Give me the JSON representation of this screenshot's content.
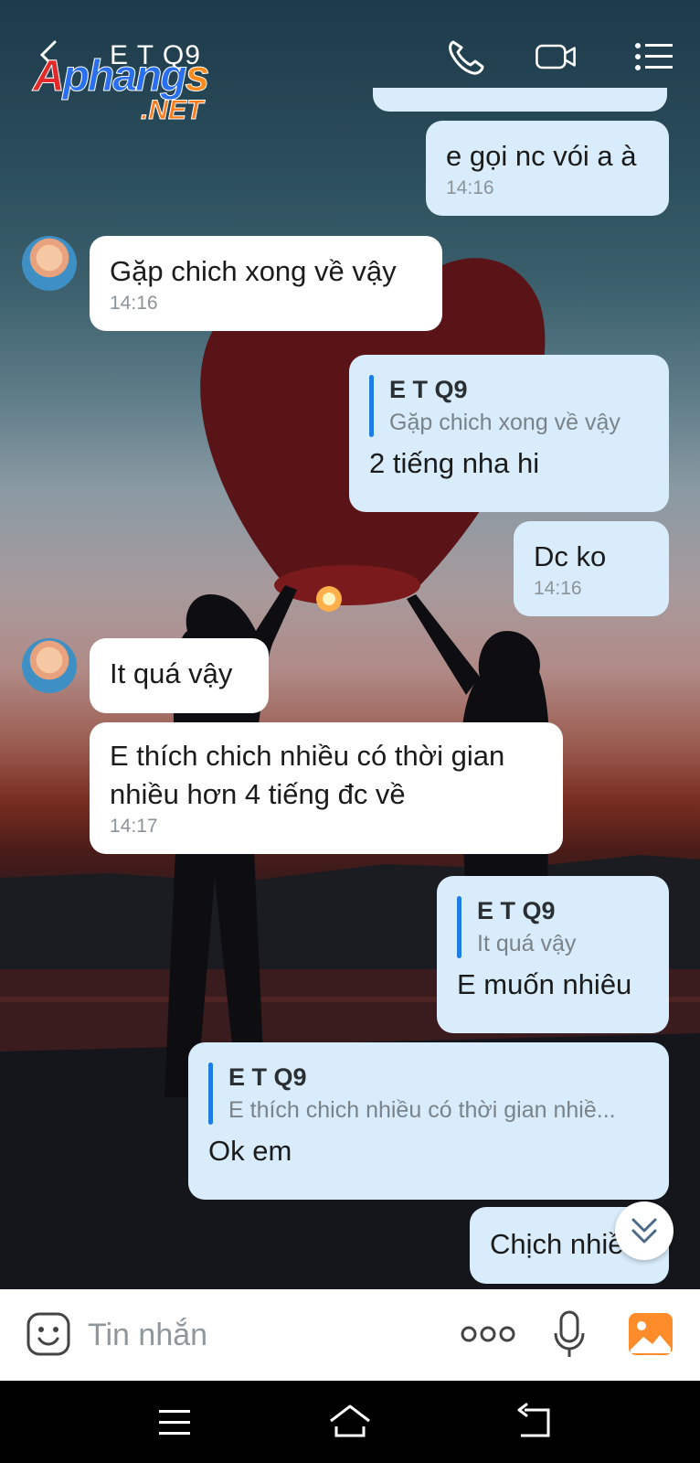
{
  "header": {
    "title": "E T Q9",
    "back_icon": "arrow-left-icon",
    "call_icon": "phone-icon",
    "video_icon": "video-icon",
    "menu_icon": "list-menu-icon"
  },
  "watermark": {
    "text_a": "A",
    "text_b": "phang",
    "text_c": "s",
    "sub": ".NET"
  },
  "messages": [
    {
      "dir": "out",
      "text": "e gọi nc vói a à",
      "time": "14:16"
    },
    {
      "dir": "in",
      "text": "Gặp chich xong về vậy",
      "time": "14:16"
    },
    {
      "dir": "out",
      "quote_name": "E T Q9",
      "quote_text": "Gặp chich xong về vậy",
      "text": "2 tiếng nha hi"
    },
    {
      "dir": "out",
      "text": "Dc ko",
      "time": "14:16"
    },
    {
      "dir": "in",
      "text": "It quá vậy"
    },
    {
      "dir": "in",
      "text_line1": "E thích chich nhiều có thời gian",
      "text_line2": "nhiều hơn 4 tiếng đc về",
      "time": "14:17"
    },
    {
      "dir": "out",
      "quote_name": "E T Q9",
      "quote_text": "It quá vậy",
      "text": "E muốn nhiêu"
    },
    {
      "dir": "out",
      "quote_name": "E T Q9",
      "quote_text": "E thích chich nhiều có thời gian nhiề...",
      "text": "Ok em"
    },
    {
      "dir": "out",
      "text": "Chịch nhiề"
    }
  ],
  "input": {
    "placeholder": "Tin nhắn",
    "emoji_icon": "sticker-smile-icon",
    "more_icon": "more-dots-icon",
    "mic_icon": "microphone-icon",
    "image_icon": "image-gallery-icon"
  },
  "scroll_icon": "double-chevron-down-icon",
  "nav": {
    "menu_icon": "nav-menu-icon",
    "home_icon": "nav-home-icon",
    "back_icon": "nav-back-icon"
  },
  "colors": {
    "outgoing_bubble": "#d8ecfb",
    "incoming_bubble": "#ffffff",
    "quote_bar": "#1e7de6",
    "image_icon": "#ff8c2a"
  }
}
